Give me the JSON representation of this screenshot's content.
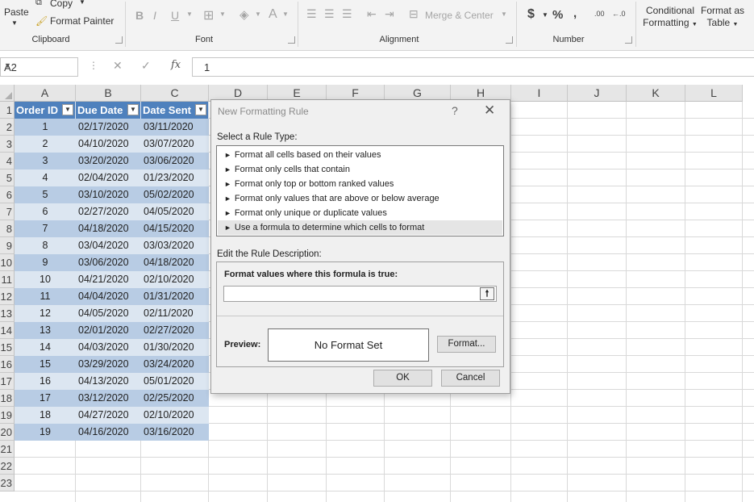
{
  "ribbon": {
    "clipboard": {
      "paste_label": "Paste",
      "copy_label": "Copy",
      "format_painter_label": "Format Painter",
      "group_label": "Clipboard"
    },
    "font": {
      "bold": "B",
      "italic": "I",
      "underline": "U",
      "font_color_glyph": "A",
      "group_label": "Font"
    },
    "alignment": {
      "merge_center_label": "Merge & Center",
      "group_label": "Alignment"
    },
    "number": {
      "currency_glyph": "$",
      "percent_glyph": "%",
      "comma_glyph": ",",
      "inc_decimal": ".00",
      "dec_decimal": "←.0",
      "group_label": "Number"
    },
    "styles": {
      "conditional_formatting_line1": "Conditional",
      "conditional_formatting_line2": "Formatting",
      "format_as_table_line1": "Format as",
      "format_as_table_line2": "Table"
    }
  },
  "formula_bar": {
    "name_box": "A2",
    "cancel_glyph": "✕",
    "enter_glyph": "✓",
    "fx_glyph": "fx",
    "value": "1"
  },
  "sheet": {
    "columns": [
      "A",
      "B",
      "C",
      "D",
      "E",
      "F",
      "G",
      "H",
      "I",
      "J",
      "K",
      "L"
    ],
    "rows": [
      "1",
      "2",
      "3",
      "4",
      "5",
      "6",
      "7",
      "8",
      "9",
      "10",
      "11",
      "12",
      "13",
      "14",
      "15",
      "16",
      "17",
      "18",
      "19",
      "20",
      "21",
      "22",
      "23"
    ],
    "table_headers": [
      "Order ID",
      "Due Date",
      "Date Sent"
    ],
    "table_rows": [
      [
        "1",
        "02/17/2020",
        "03/11/2020"
      ],
      [
        "2",
        "04/10/2020",
        "03/07/2020"
      ],
      [
        "3",
        "03/20/2020",
        "03/06/2020"
      ],
      [
        "4",
        "02/04/2020",
        "01/23/2020"
      ],
      [
        "5",
        "03/10/2020",
        "05/02/2020"
      ],
      [
        "6",
        "02/27/2020",
        "04/05/2020"
      ],
      [
        "7",
        "04/18/2020",
        "04/15/2020"
      ],
      [
        "8",
        "03/04/2020",
        "03/03/2020"
      ],
      [
        "9",
        "03/06/2020",
        "04/18/2020"
      ],
      [
        "10",
        "04/21/2020",
        "02/10/2020"
      ],
      [
        "11",
        "04/04/2020",
        "01/31/2020"
      ],
      [
        "12",
        "04/05/2020",
        "02/11/2020"
      ],
      [
        "13",
        "02/01/2020",
        "02/27/2020"
      ],
      [
        "14",
        "04/03/2020",
        "01/30/2020"
      ],
      [
        "15",
        "03/29/2020",
        "03/24/2020"
      ],
      [
        "16",
        "04/13/2020",
        "05/01/2020"
      ],
      [
        "17",
        "03/12/2020",
        "02/25/2020"
      ],
      [
        "18",
        "04/27/2020",
        "02/10/2020"
      ],
      [
        "19",
        "04/16/2020",
        "03/16/2020"
      ]
    ],
    "header_color": "#4f81bd",
    "band_color_dark": "#b8cce4",
    "band_color_light": "#dce6f1"
  },
  "dialog": {
    "title": "New Formatting Rule",
    "help_glyph": "?",
    "close_glyph": "✕",
    "select_rule_label": "Select a Rule Type:",
    "rules": [
      "Format all cells based on their values",
      "Format only cells that contain",
      "Format only top or bottom ranked values",
      "Format only values that are above or below average",
      "Format only unique or duplicate values",
      "Use a formula to determine which cells to format"
    ],
    "rule_bullet": "►",
    "selected_rule_index": 5,
    "edit_desc_label": "Edit the Rule Description:",
    "formula_label": "Format values where this formula is true:",
    "formula_value": "",
    "preview_label": "Preview:",
    "preview_text": "No Format Set",
    "format_button": "Format...",
    "ok_button": "OK",
    "cancel_button": "Cancel"
  }
}
